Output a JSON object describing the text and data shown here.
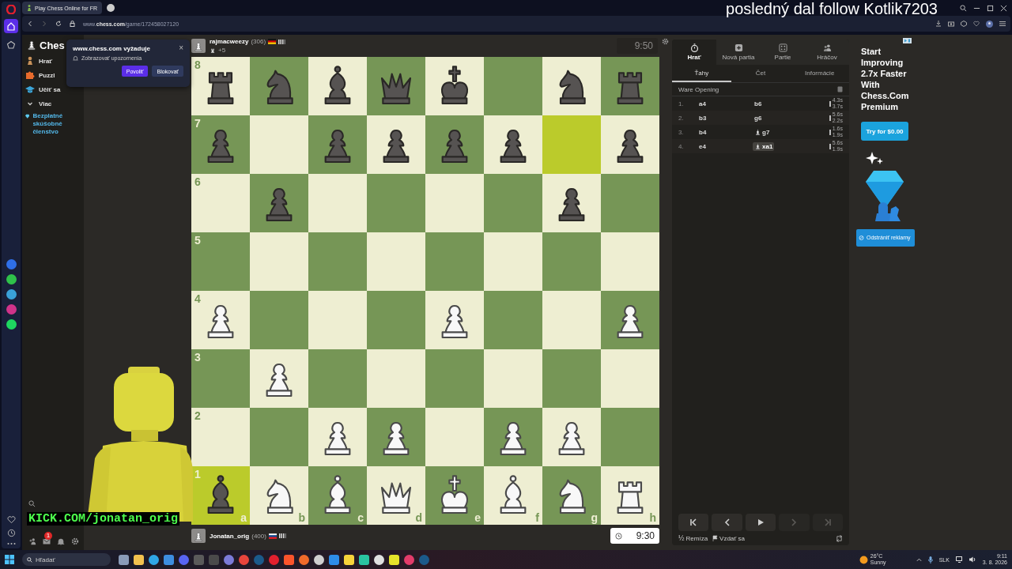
{
  "browser": {
    "tab_title": "Play Chess Online for FR",
    "url": "www.**chess.com**/game/172458027120",
    "sidebar": [
      {
        "kind": "home",
        "selected": true
      },
      {
        "kind": "pinboard",
        "selected": false
      }
    ]
  },
  "permission_popup": {
    "title": "www.chess.com vyžaduje",
    "close": "×",
    "message": "Zobrazovať upozornenia",
    "buttons": [
      "Povoliť",
      "Blokovať"
    ]
  },
  "nav": {
    "logo": "Ches",
    "items": [
      {
        "kind": "play",
        "label": "Hrať"
      },
      {
        "kind": "puzzles",
        "label": "Puzzl"
      },
      {
        "kind": "learn",
        "label": "Učiť sa"
      },
      {
        "kind": "more",
        "label": "Viac"
      }
    ],
    "promo": "Bezplatné skúšobné členstvo",
    "mail_badge": "1"
  },
  "top_player": {
    "name": "rajmacweezy",
    "rating": "(306)",
    "advantage": "+5",
    "clock": "9:50"
  },
  "bottom_player": {
    "name": "Jonatan_orig",
    "rating": "(400)",
    "clock": "9:30"
  },
  "board": {
    "files": [
      "a",
      "b",
      "c",
      "d",
      "e",
      "f",
      "g",
      "h"
    ],
    "ranks": [
      {
        "label": "8",
        "squares": [
          {
            "kind": "black_rook",
            "highlighted": false
          },
          {
            "kind": "black_knight",
            "highlighted": false
          },
          {
            "kind": "black_bishop",
            "highlighted": false
          },
          {
            "kind": "black_queen",
            "highlighted": false
          },
          {
            "kind": "black_king",
            "highlighted": false
          },
          {
            "kind": "empty",
            "highlighted": false
          },
          {
            "kind": "black_knight",
            "highlighted": false
          },
          {
            "kind": "black_rook",
            "highlighted": false
          }
        ]
      },
      {
        "label": "7",
        "squares": [
          {
            "kind": "black_pawn",
            "highlighted": false
          },
          {
            "kind": "empty",
            "highlighted": false
          },
          {
            "kind": "black_pawn",
            "highlighted": false
          },
          {
            "kind": "black_pawn",
            "highlighted": false
          },
          {
            "kind": "black_pawn",
            "highlighted": false
          },
          {
            "kind": "black_pawn",
            "highlighted": false
          },
          {
            "kind": "empty",
            "highlighted": true
          },
          {
            "kind": "black_pawn",
            "highlighted": false
          }
        ]
      },
      {
        "label": "6",
        "squares": [
          {
            "kind": "empty",
            "highlighted": false
          },
          {
            "kind": "black_pawn",
            "highlighted": false
          },
          {
            "kind": "empty",
            "highlighted": false
          },
          {
            "kind": "empty",
            "highlighted": false
          },
          {
            "kind": "empty",
            "highlighted": false
          },
          {
            "kind": "empty",
            "highlighted": false
          },
          {
            "kind": "black_pawn",
            "highlighted": false
          },
          {
            "kind": "empty",
            "highlighted": false
          }
        ]
      },
      {
        "label": "5",
        "squares": [
          {
            "kind": "empty",
            "highlighted": false
          },
          {
            "kind": "empty",
            "highlighted": false
          },
          {
            "kind": "empty",
            "highlighted": false
          },
          {
            "kind": "empty",
            "highlighted": false
          },
          {
            "kind": "empty",
            "highlighted": false
          },
          {
            "kind": "empty",
            "highlighted": false
          },
          {
            "kind": "empty",
            "highlighted": false
          },
          {
            "kind": "empty",
            "highlighted": false
          }
        ]
      },
      {
        "label": "4",
        "squares": [
          {
            "kind": "white_pawn",
            "highlighted": false
          },
          {
            "kind": "empty",
            "highlighted": false
          },
          {
            "kind": "empty",
            "highlighted": false
          },
          {
            "kind": "empty",
            "highlighted": false
          },
          {
            "kind": "white_pawn",
            "highlighted": false
          },
          {
            "kind": "empty",
            "highlighted": false
          },
          {
            "kind": "empty",
            "highlighted": false
          },
          {
            "kind": "white_pawn",
            "highlighted": false
          }
        ]
      },
      {
        "label": "3",
        "squares": [
          {
            "kind": "empty",
            "highlighted": false
          },
          {
            "kind": "white_pawn",
            "highlighted": false
          },
          {
            "kind": "empty",
            "highlighted": false
          },
          {
            "kind": "empty",
            "highlighted": false
          },
          {
            "kind": "empty",
            "highlighted": false
          },
          {
            "kind": "empty",
            "highlighted": false
          },
          {
            "kind": "empty",
            "highlighted": false
          },
          {
            "kind": "empty",
            "highlighted": false
          }
        ]
      },
      {
        "label": "2",
        "squares": [
          {
            "kind": "empty",
            "highlighted": false
          },
          {
            "kind": "empty",
            "highlighted": false
          },
          {
            "kind": "white_pawn",
            "highlighted": false
          },
          {
            "kind": "white_pawn",
            "highlighted": false
          },
          {
            "kind": "empty",
            "highlighted": false
          },
          {
            "kind": "white_pawn",
            "highlighted": false
          },
          {
            "kind": "white_pawn",
            "highlighted": false
          },
          {
            "kind": "empty",
            "highlighted": false
          }
        ]
      },
      {
        "label": "1",
        "squares": [
          {
            "kind": "black_bishop",
            "highlighted": true
          },
          {
            "kind": "white_knight",
            "highlighted": false
          },
          {
            "kind": "white_bishop",
            "highlighted": false
          },
          {
            "kind": "white_queen",
            "highlighted": false
          },
          {
            "kind": "white_king",
            "highlighted": false
          },
          {
            "kind": "white_bishop",
            "highlighted": false
          },
          {
            "kind": "white_knight",
            "highlighted": false
          },
          {
            "kind": "white_rook",
            "highlighted": false
          }
        ]
      }
    ]
  },
  "panel": {
    "nav_tabs": [
      {
        "kind": "play",
        "label": "Hrať",
        "selected": true
      },
      {
        "kind": "new",
        "label": "Nová partia",
        "selected": false
      },
      {
        "kind": "games",
        "label": "Partie",
        "selected": false
      },
      {
        "kind": "players",
        "label": "Hráčov",
        "selected": false
      }
    ],
    "tabs": [
      {
        "label": "Ťahy",
        "selected": true
      },
      {
        "label": "Čet",
        "selected": false
      },
      {
        "label": "Informácie",
        "selected": false
      }
    ],
    "opening": "Ware Opening",
    "moves": [
      {
        "number": "1.",
        "white": {
          "text": "a4",
          "selected": false
        },
        "black": {
          "text": "b6",
          "selected": false
        },
        "times": [
          "4.3s",
          "3.7s"
        ]
      },
      {
        "number": "2.",
        "white": {
          "text": "b3",
          "selected": false
        },
        "black": {
          "text": "g6",
          "selected": false
        },
        "times": [
          "5.6s",
          "2.2s"
        ]
      },
      {
        "number": "3.",
        "white": {
          "text": "b4",
          "selected": false
        },
        "black": {
          "kind": "bishop",
          "text": "g7",
          "selected": false
        },
        "times": [
          "1.6s",
          "1.9s"
        ]
      },
      {
        "number": "4.",
        "white": {
          "text": "e4",
          "selected": false
        },
        "black": {
          "kind": "bishop",
          "text": "xa1",
          "selected": true
        },
        "times": [
          "5.6s",
          "1.9s"
        ]
      }
    ],
    "controls": [
      {
        "kind": "first",
        "disabled": false
      },
      {
        "kind": "prev",
        "disabled": false
      },
      {
        "kind": "play",
        "disabled": false
      },
      {
        "kind": "next",
        "disabled": true
      },
      {
        "kind": "last",
        "disabled": true
      }
    ],
    "draw_icon": "½",
    "draw": "Remíza",
    "resign": "Vzdať sa"
  },
  "ad": {
    "headline": "Start Improving 2.7x Faster With Chess.Com Premium",
    "cta": "Try for $0.00",
    "remove_ads": "Odstrániť reklamy"
  },
  "overlay": {
    "follow_text": "posledný dal follow Kotlik7203",
    "channel": "KICK.COM/jonatan_orig"
  },
  "taskbar": {
    "search": "Hľadať",
    "temperature": "26°C",
    "weather": "Sunny",
    "language": "SLK",
    "time": "9:11",
    "date": "3. 8. 2026"
  }
}
